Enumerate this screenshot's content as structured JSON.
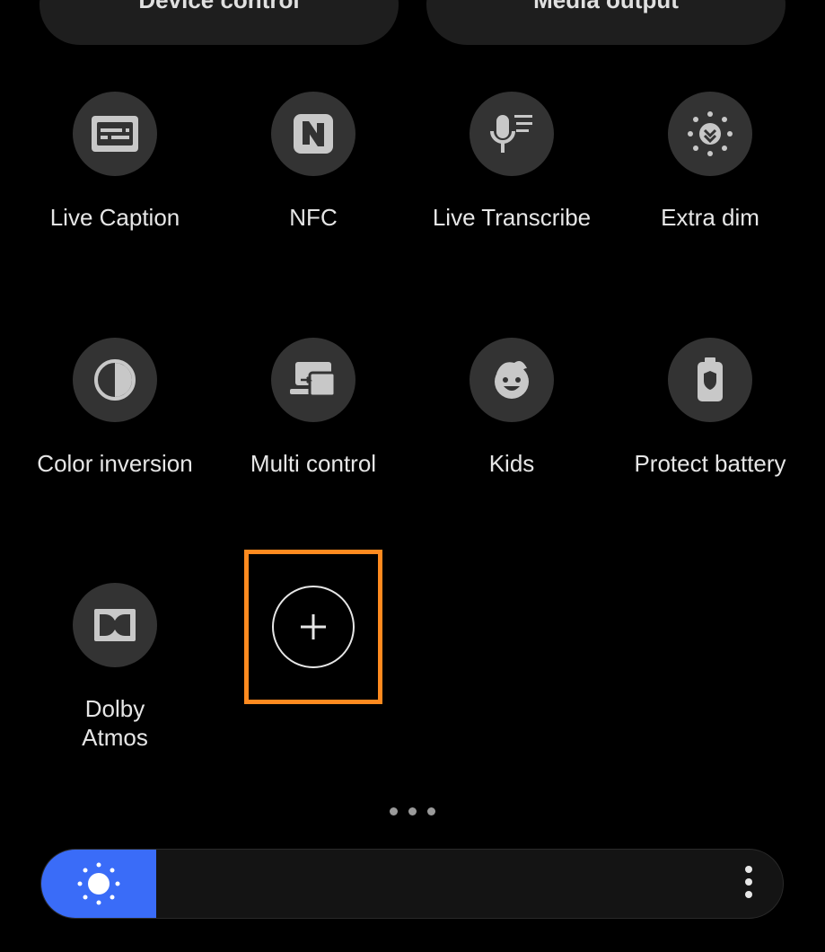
{
  "top_buttons": [
    {
      "label": "Device control"
    },
    {
      "label": "Media output"
    }
  ],
  "tiles": [
    {
      "label": "Live Caption",
      "icon": "live-caption-icon"
    },
    {
      "label": "NFC",
      "icon": "nfc-icon"
    },
    {
      "label": "Live Transcribe",
      "icon": "live-transcribe-icon"
    },
    {
      "label": "Extra dim",
      "icon": "extra-dim-icon"
    },
    {
      "label": "Color inversion",
      "icon": "color-inversion-icon"
    },
    {
      "label": "Multi control",
      "icon": "multi-control-icon"
    },
    {
      "label": "Kids",
      "icon": "kids-icon"
    },
    {
      "label": "Protect battery",
      "icon": "protect-battery-icon"
    },
    {
      "label": "Dolby\nAtmos",
      "icon": "dolby-atmos-icon"
    }
  ],
  "add_tile": {
    "icon": "plus-icon",
    "highlight_color": "#ff8a1f"
  },
  "pager": {
    "dots": 3
  },
  "brightness": {
    "level": 0.155,
    "icon": "sun-icon",
    "accent": "#3a6cf8"
  },
  "colors": {
    "tile_bg": "#333333",
    "background": "#000000"
  }
}
